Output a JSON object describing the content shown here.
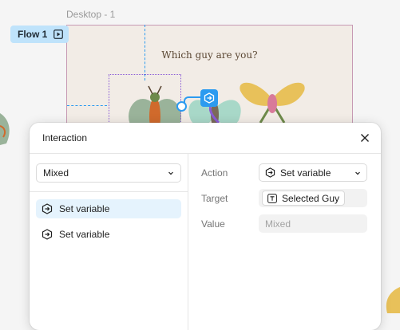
{
  "canvas": {
    "frame_label": "Desktop - 1",
    "flow_label": "Flow 1",
    "frame_title": "Which guy are you?"
  },
  "dialog": {
    "title": "Interaction",
    "trigger_select": "Mixed",
    "actions": [
      {
        "label": "Set variable"
      },
      {
        "label": "Set variable"
      }
    ],
    "action_label": "Action",
    "action_value": "Set variable",
    "target_label": "Target",
    "target_value": "Selected Guy",
    "value_label": "Value",
    "value_placeholder": "Mixed"
  },
  "icons": [
    "play-flow-icon",
    "variable-icon",
    "chevron-down-icon",
    "close-icon",
    "text-variable-icon"
  ],
  "colors": {
    "accent": "#2c9bf0",
    "selection_bg": "#e5f3fd",
    "flow_tag_bg": "#bfe3fb"
  }
}
